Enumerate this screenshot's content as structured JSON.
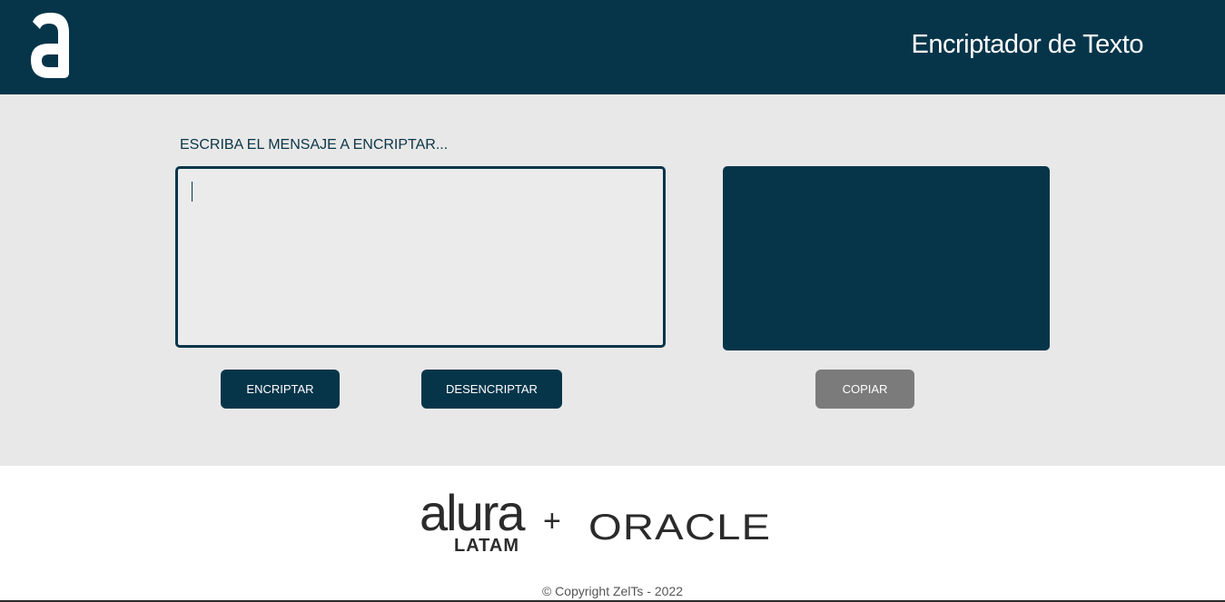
{
  "header": {
    "logo_icon": "alura-a-logo-icon",
    "title": "Encriptador de Texto"
  },
  "main": {
    "input_label": "ESCRIBA EL MENSAJE A ENCRIPTAR...",
    "input_value": "",
    "output_value": "",
    "encrypt_label": "ENCRIPTAR",
    "decrypt_label": "DESENCRIPTAR",
    "copy_label": "COPIAR"
  },
  "footer": {
    "alura_word": "alura",
    "alura_latam": "LATAM",
    "plus": "+",
    "oracle": "ORACLE",
    "copyright": "© Copyright ZelTs - 2022"
  },
  "colors": {
    "primary": "#06354a",
    "background": "#e8e8e8",
    "copy_button": "#7b7b7b"
  }
}
